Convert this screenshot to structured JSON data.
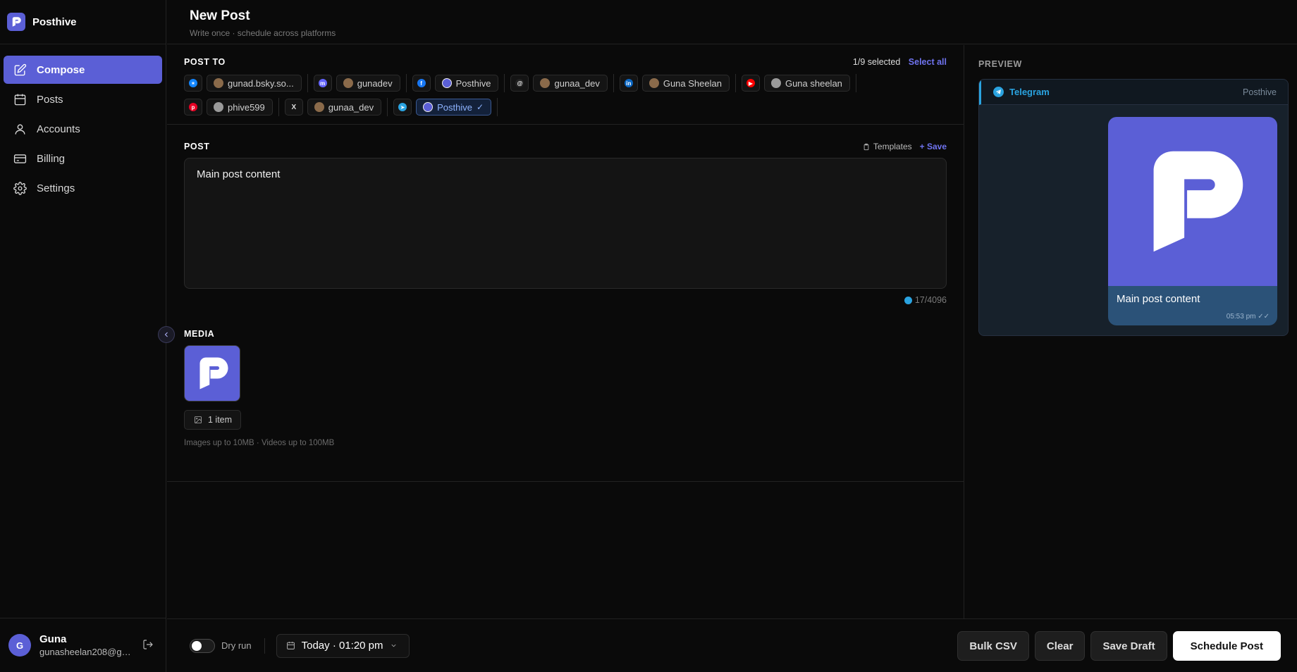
{
  "brand": {
    "name": "Posthive"
  },
  "sidebar": {
    "items": [
      {
        "label": "Compose",
        "icon": "compose-icon",
        "active": true
      },
      {
        "label": "Posts",
        "icon": "calendar-icon",
        "active": false
      },
      {
        "label": "Accounts",
        "icon": "user-icon",
        "active": false
      },
      {
        "label": "Billing",
        "icon": "card-icon",
        "active": false
      },
      {
        "label": "Settings",
        "icon": "gear-icon",
        "active": false
      }
    ]
  },
  "user": {
    "initial": "G",
    "name": "Guna",
    "email": "gunasheelan208@gm..."
  },
  "header": {
    "title": "New Post",
    "subtitle": "Write once · schedule across platforms"
  },
  "post_to": {
    "title": "POST TO",
    "selected_count": "1/9 selected",
    "select_all": "Select all",
    "accounts": [
      {
        "platform": "bluesky-icon",
        "color": "#1185fe",
        "name": "gunad.bsky.so...",
        "selected": false
      },
      {
        "platform": "mastodon-icon",
        "color": "#6364ff",
        "name": "gunadev",
        "selected": false
      },
      {
        "platform": "facebook-icon",
        "color": "#1877f2",
        "name": "Posthive",
        "selected": false
      },
      {
        "platform": "threads-icon",
        "color": "#222222",
        "name": "gunaa_dev",
        "selected": false
      },
      {
        "platform": "linkedin-icon",
        "color": "#0a66c2",
        "name": "Guna Sheelan",
        "selected": false
      },
      {
        "platform": "youtube-icon",
        "color": "#ff0000",
        "name": "Guna sheelan",
        "selected": false
      },
      {
        "platform": "pinterest-icon",
        "color": "#e60023",
        "name": "phive599",
        "selected": false
      },
      {
        "platform": "x-icon",
        "color": "#000000",
        "name": "gunaa_dev",
        "selected": false
      },
      {
        "platform": "telegram-icon",
        "color": "#2aa3e0",
        "name": "Posthive",
        "selected": true
      }
    ]
  },
  "post": {
    "title": "POST",
    "templates": "Templates",
    "save": "+ Save",
    "content": "Main post content",
    "counter": "17/4096"
  },
  "media": {
    "title": "MEDIA",
    "count_label": "1 item",
    "note": "Images up to 10MB · Videos up to 100MB"
  },
  "preview": {
    "title": "PREVIEW",
    "platform": "Telegram",
    "account": "Posthive",
    "message": "Main post content",
    "time": "05:53 pm ✓✓"
  },
  "bottom": {
    "dry_run": "Dry run",
    "schedule_date": "Today · 01:20 pm",
    "bulk_csv": "Bulk CSV",
    "clear": "Clear",
    "save_draft": "Save Draft",
    "schedule_post": "Schedule Post"
  },
  "colors": {
    "accent": "#5b5fd6",
    "telegram": "#2aa3e0",
    "background": "#0a0a0a"
  }
}
